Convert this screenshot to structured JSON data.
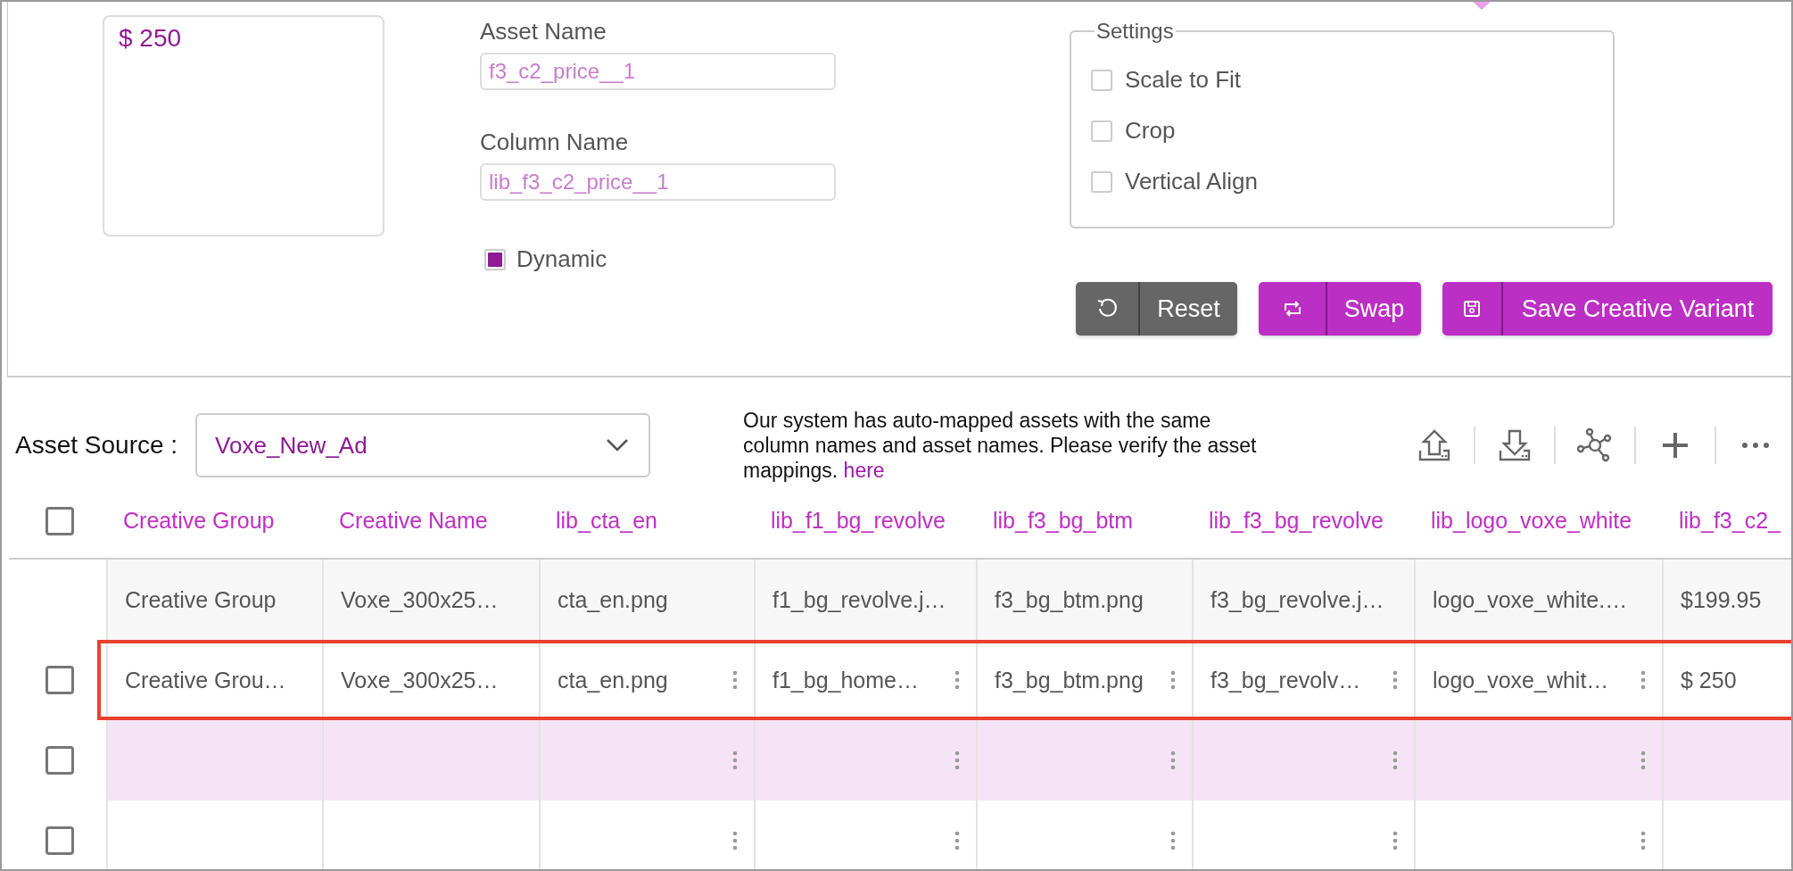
{
  "preview": {
    "text": "$ 250"
  },
  "fields": [
    {
      "label": "Asset Name",
      "value": "f3_c2_price__1"
    },
    {
      "label": "Column Name",
      "value": "lib_f3_c2_price__1"
    }
  ],
  "dynamic": {
    "label": "Dynamic",
    "checked": true
  },
  "settings": {
    "title": "Settings",
    "options": [
      {
        "label": "Scale to Fit",
        "checked": false
      },
      {
        "label": "Crop",
        "checked": false
      },
      {
        "label": "Vertical Align",
        "checked": false
      }
    ]
  },
  "buttons": [
    {
      "label": "Reset",
      "kind": "reset"
    },
    {
      "label": "Swap",
      "kind": "swap"
    },
    {
      "label": "Save Creative Variant",
      "kind": "save"
    }
  ],
  "asset_source": {
    "label": "Asset Source :",
    "value": "Voxe_New_Ad"
  },
  "notice": {
    "text": "Our system has auto-mapped assets with the same column names and asset names. Please verify the asset mappings.",
    "link": "here"
  },
  "table": {
    "select_all_checked": false,
    "columns": [
      "Creative Group",
      "Creative Name",
      "lib_cta_en",
      "lib_f1_bg_revolve",
      "lib_f3_bg_btm",
      "lib_f3_bg_revolve",
      "lib_logo_voxe_white",
      "lib_f3_c2_"
    ],
    "rows": [
      {
        "kind": "reference",
        "selected": false,
        "highlighted": false,
        "cells": [
          {
            "text": "Creative Group",
            "menu": false
          },
          {
            "text": "Voxe_300x25…",
            "menu": false
          },
          {
            "text": "cta_en.png",
            "menu": false
          },
          {
            "text": "f1_bg_revolve.j…",
            "menu": false
          },
          {
            "text": "f3_bg_btm.png",
            "menu": false
          },
          {
            "text": "f3_bg_revolve.j…",
            "menu": false
          },
          {
            "text": "logo_voxe_white.…",
            "menu": false
          },
          {
            "text": "$199.95",
            "menu": false
          }
        ]
      },
      {
        "kind": "mapping",
        "checked": false,
        "selected": true,
        "highlighted": false,
        "cells": [
          {
            "text": "Creative Grou…",
            "menu": false
          },
          {
            "text": "Voxe_300x25…",
            "menu": false
          },
          {
            "text": "cta_en.png",
            "menu": true
          },
          {
            "text": "f1_bg_home…",
            "menu": true
          },
          {
            "text": "f3_bg_btm.png",
            "menu": true
          },
          {
            "text": "f3_bg_revolv…",
            "menu": true
          },
          {
            "text": "logo_voxe_whit…",
            "menu": true
          },
          {
            "text": "$ 250",
            "menu": false
          }
        ]
      },
      {
        "kind": "mapping",
        "checked": false,
        "selected": false,
        "highlighted": true,
        "cells": [
          {
            "menu": false
          },
          {
            "menu": false
          },
          {
            "menu": true
          },
          {
            "menu": true
          },
          {
            "menu": true
          },
          {
            "menu": true
          },
          {
            "menu": true
          },
          {
            "menu": false
          }
        ]
      },
      {
        "kind": "mapping",
        "checked": false,
        "selected": false,
        "highlighted": false,
        "cells": [
          {
            "menu": false
          },
          {
            "menu": false
          },
          {
            "menu": true
          },
          {
            "menu": true
          },
          {
            "menu": true
          },
          {
            "menu": true
          },
          {
            "menu": true
          },
          {
            "menu": false
          }
        ]
      }
    ]
  }
}
